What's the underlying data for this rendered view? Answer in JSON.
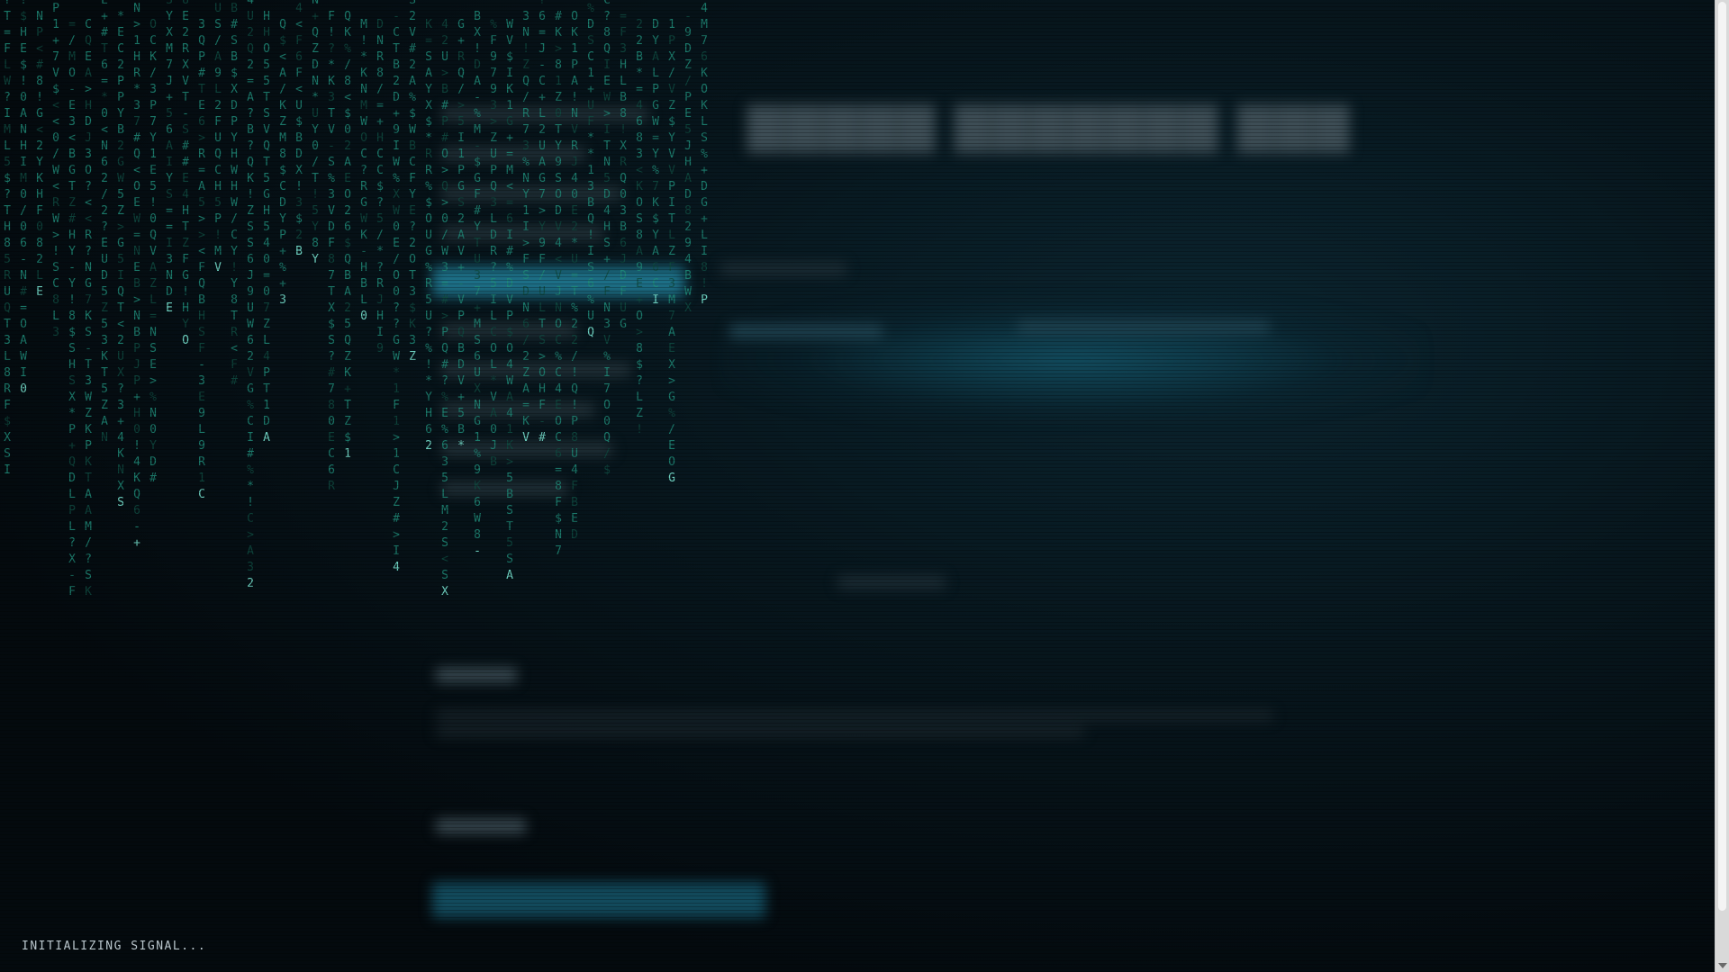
{
  "status": {
    "text": "INITIALIZING SIGNAL..."
  },
  "matrix": {
    "charset": "ABCDEFGHIJKLMNOPQRSTUVWXYZ0123456789$%#=+*<>/?!-",
    "glyph_color": "#1f8a78",
    "head_color": "#7ff0dc"
  },
  "theme": {
    "background": "#050a0d",
    "accent": "#1d6f86",
    "status_text": "#b9c6cc"
  }
}
